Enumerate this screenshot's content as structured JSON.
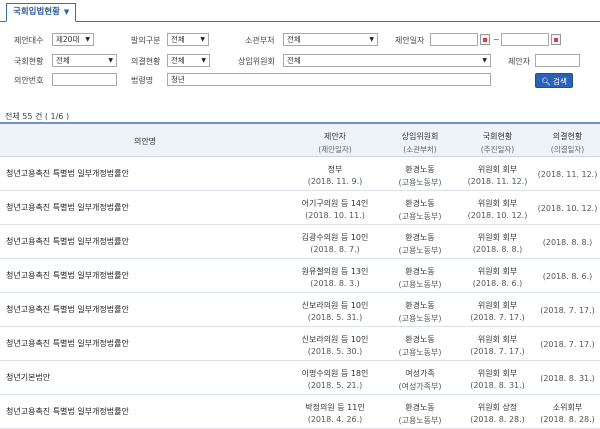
{
  "tab": {
    "label": "국회입법현황"
  },
  "form": {
    "proposal_term_label": "제안대수",
    "proposal_term_value": "제20대",
    "bill_type_label": "발의구분",
    "bill_type_value": "전체",
    "ministry_label": "소관부처",
    "ministry_value": "전체",
    "proposal_date_label": "제안일자",
    "date_from": "",
    "date_sep": "~",
    "date_to": "",
    "assembly_status_label": "국회현황",
    "assembly_status_value": "전체",
    "decision_status_label": "의결현황",
    "decision_status_value": "전체",
    "committee_label": "상임위원회",
    "committee_value": "전체",
    "proposer_label": "제안자",
    "proposer_value": "",
    "bill_no_label": "의안번호",
    "bill_no_value": "",
    "bill_name_label": "법령명",
    "bill_name_value": "청년",
    "search_label": "검색"
  },
  "summary": "전체 55 건 ( 1/6 )",
  "table": {
    "headers": [
      {
        "main": "의안명",
        "sub": ""
      },
      {
        "main": "제안자",
        "sub": "(제안일자)"
      },
      {
        "main": "상임위원회",
        "sub": "(소관부처)"
      },
      {
        "main": "국회현황",
        "sub": "(추진일자)"
      },
      {
        "main": "의결현황",
        "sub": "(의결일자)"
      }
    ],
    "rows": [
      {
        "title": "청년고용촉진 특별법 일부개정법률안",
        "proposer": "정부",
        "prop_date": "(2018. 11. 9.)",
        "committee": "환경노동",
        "ministry": "(고용노동부)",
        "status": "위원회 회부",
        "status_date": "(2018. 11. 12.)",
        "decision": "",
        "decision_date": "(2018. 11. 12.)"
      },
      {
        "title": "청년고용촉진 특별법 일부개정법률안",
        "proposer": "어기구의원 등 14인",
        "prop_date": "(2018. 10. 11.)",
        "committee": "환경노동",
        "ministry": "(고용노동부)",
        "status": "위원회 회부",
        "status_date": "(2018. 10. 12.)",
        "decision": "",
        "decision_date": "(2018. 10. 12.)"
      },
      {
        "title": "청년고용촉진 특별법 일부개정법률안",
        "proposer": "김광수의원 등 10인",
        "prop_date": "(2018. 8. 7.)",
        "committee": "환경노동",
        "ministry": "(고용노동부)",
        "status": "위원회 회부",
        "status_date": "(2018. 8. 8.)",
        "decision": "",
        "decision_date": "(2018. 8. 8.)"
      },
      {
        "title": "청년고용촉진 특별법 일부개정법률안",
        "proposer": "원유철의원 등 13인",
        "prop_date": "(2018. 8. 3.)",
        "committee": "환경노동",
        "ministry": "(고용노동부)",
        "status": "위원회 회부",
        "status_date": "(2018. 8. 6.)",
        "decision": "",
        "decision_date": "(2018. 8. 6.)"
      },
      {
        "title": "청년고용촉진 특별법 일부개정법률안",
        "proposer": "신보라의원 등 10인",
        "prop_date": "(2018. 5. 31.)",
        "committee": "환경노동",
        "ministry": "(고용노동부)",
        "status": "위원회 회부",
        "status_date": "(2018. 7. 17.)",
        "decision": "",
        "decision_date": "(2018. 7. 17.)"
      },
      {
        "title": "청년고용촉진 특별법 일부개정법률안",
        "proposer": "신보라의원 등 10인",
        "prop_date": "(2018. 5. 30.)",
        "committee": "환경노동",
        "ministry": "(고용노동부)",
        "status": "위원회 회부",
        "status_date": "(2018. 7. 17.)",
        "decision": "",
        "decision_date": "(2018. 7. 17.)"
      },
      {
        "title": "청년기본법안",
        "proposer": "이명수의원 등 18인",
        "prop_date": "(2018. 5. 21.)",
        "committee": "여성가족",
        "ministry": "(여성가족부)",
        "status": "위원회 회부",
        "status_date": "(2018. 8. 31.)",
        "decision": "",
        "decision_date": "(2018. 8. 31.)"
      },
      {
        "title": "청년고용촉진 특별법 일부개정법률안",
        "proposer": "박정의원 등 11인",
        "prop_date": "(2018. 4. 26.)",
        "committee": "환경노동",
        "ministry": "(고용노동부)",
        "status": "위원회 상정",
        "status_date": "(2018. 8. 28.)",
        "decision": "소위회부",
        "decision_date": "(2018. 8. 28.)"
      }
    ]
  }
}
